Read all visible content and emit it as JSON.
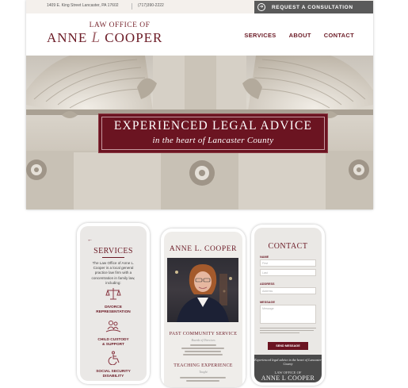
{
  "desktop": {
    "topbar": {
      "address": "1409 E. King Street Lancaster, PA 17602",
      "phone": "(717)390-2222",
      "cta_label": "REQUEST A CONSULTATION"
    },
    "logo": {
      "line1": "LAW OFFICE OF",
      "first": "ANNE",
      "initial": "L",
      "last": "COOPER"
    },
    "nav": [
      "SERVICES",
      "ABOUT",
      "CONTACT"
    ],
    "hero": {
      "title": "EXPERIENCED LEGAL ADVICE",
      "subtitle": "in the heart of Lancaster County"
    }
  },
  "phone_services": {
    "back": "←",
    "title": "SERVICES",
    "description": "The Law Office of Anne L. Cooper is a local general practice law firm with a concentration in family law, including:",
    "items": [
      {
        "icon": "scales-heart-icon",
        "glyph": "⚖",
        "label_l1": "DIVORCE",
        "label_l2": "REPRESENTATION"
      },
      {
        "icon": "family-hands-icon",
        "glyph": "👪",
        "label_l1": "CHILD CUSTODY",
        "label_l2": "& SUPPORT"
      },
      {
        "icon": "wheelchair-icon",
        "glyph": "♿",
        "label_l1": "SOCIAL SECURITY",
        "label_l2": "DISABILITY"
      }
    ]
  },
  "phone_about": {
    "name": "ANNE L. COOPER",
    "section1": {
      "heading": "PAST COMMUNITY SERVICE",
      "sub": "Boards of Directors"
    },
    "section2": {
      "heading": "TEACHING EXPERIENCE",
      "sub": "Taught"
    }
  },
  "phone_contact": {
    "title": "CONTACT",
    "name_label": "NAME",
    "first_placeholder": "First",
    "last_placeholder": "Last",
    "address_label": "ADDRESS",
    "address_placeholder": "Address",
    "message_label": "MESSAGE",
    "message_placeholder": "Message",
    "send_label": "SEND MESSAGE",
    "footer_tagline": "Experienced legal advice in the heart of Lancaster County",
    "footer_logo_line1": "LAW OFFICE OF",
    "footer_logo_line2": "ANNE L COOPER"
  },
  "colors": {
    "brand": "#6b1a25",
    "banner": "#6b1421",
    "topbar_bg": "#f4f0ec",
    "cta_bg": "#5a5a5a",
    "footer_bg": "#4b4b4b"
  }
}
